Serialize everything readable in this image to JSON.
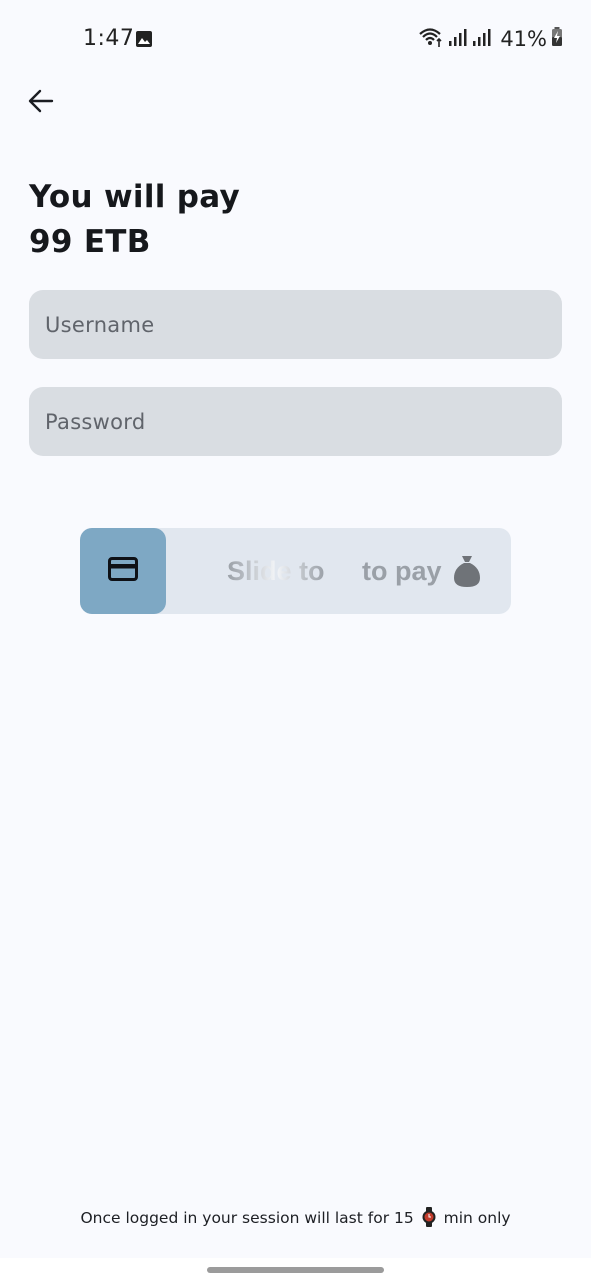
{
  "status_bar": {
    "time": "1:47",
    "battery": "41%",
    "icons": [
      "gallery-icon",
      "wifi-icon",
      "signal-icon",
      "signal-icon",
      "battery-charging-icon"
    ]
  },
  "header": {
    "back_icon": "arrow-left-icon"
  },
  "payment": {
    "line1": "You will pay",
    "line2": "99 ETB"
  },
  "form": {
    "username_placeholder": "Username",
    "password_placeholder": "Password"
  },
  "slider": {
    "label_start": "Slide to",
    "label_end": "to pay",
    "handle_icon": "credit-card-icon",
    "trailing_icon": "money-bag-icon"
  },
  "footer": {
    "note_before": "Once logged in your session will last for 15",
    "note_after": "min only",
    "icon": "watch-icon"
  },
  "colors": {
    "background": "#f9fafe",
    "input_fill": "#d9dde2",
    "slider_track": "#e1e7ef",
    "slider_handle": "#7ea8c4",
    "text_dark": "#16181c"
  }
}
